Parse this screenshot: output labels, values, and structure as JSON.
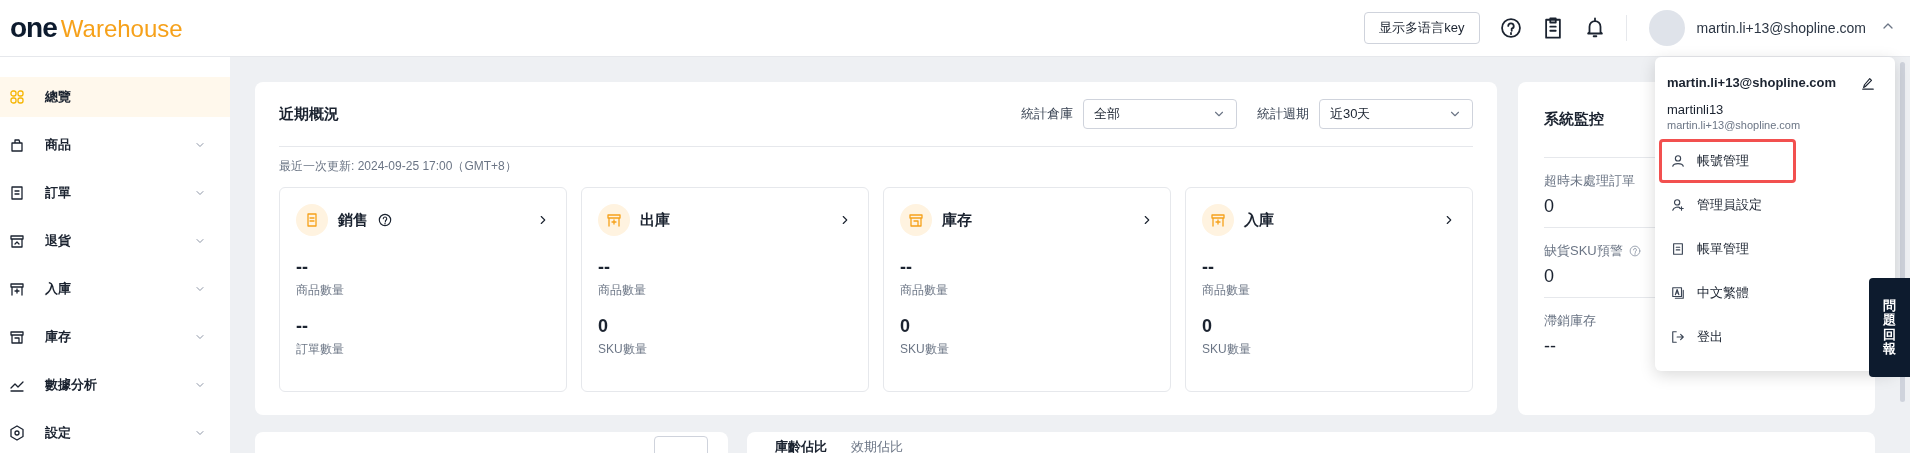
{
  "header": {
    "logo_one": "one",
    "logo_word": "Warehouse",
    "lang_key_button": "显示多语言key",
    "user_email": "martin.li+13@shopline.com",
    "menu_expanded": true
  },
  "sidebar": {
    "items": [
      {
        "label": "總覽",
        "selected": true,
        "expandable": false
      },
      {
        "label": "商品",
        "selected": false,
        "expandable": true
      },
      {
        "label": "訂單",
        "selected": false,
        "expandable": true
      },
      {
        "label": "退貨",
        "selected": false,
        "expandable": true
      },
      {
        "label": "入庫",
        "selected": false,
        "expandable": true
      },
      {
        "label": "庫存",
        "selected": false,
        "expandable": true
      },
      {
        "label": "數據分析",
        "selected": false,
        "expandable": true
      },
      {
        "label": "設定",
        "selected": false,
        "expandable": true
      }
    ]
  },
  "overview": {
    "title": "近期概況",
    "filters": [
      {
        "label": "統計倉庫",
        "value": "全部"
      },
      {
        "label": "統計週期",
        "value": "近30天"
      }
    ],
    "updated": "最近一次更新: 2024-09-25 17:00（GMT+8）",
    "cards": [
      {
        "title": "銷售",
        "help": true,
        "metrics": [
          {
            "value": "--",
            "label": "商品數量"
          },
          {
            "value": "--",
            "label": "訂單數量"
          }
        ]
      },
      {
        "title": "出庫",
        "help": false,
        "metrics": [
          {
            "value": "--",
            "label": "商品數量"
          },
          {
            "value": "0",
            "label": "SKU數量"
          }
        ]
      },
      {
        "title": "庫存",
        "help": false,
        "metrics": [
          {
            "value": "--",
            "label": "商品數量"
          },
          {
            "value": "0",
            "label": "SKU數量"
          }
        ]
      },
      {
        "title": "入庫",
        "help": false,
        "metrics": [
          {
            "value": "--",
            "label": "商品數量"
          },
          {
            "value": "0",
            "label": "SKU數量"
          }
        ]
      }
    ]
  },
  "monitor": {
    "title": "系統監控",
    "items": [
      {
        "label": "超時未處理訂單",
        "value": "0",
        "help": false
      },
      {
        "label": "缺貨SKU預警",
        "value": "0",
        "help": true
      },
      {
        "label": "滯銷庫存",
        "value": "--",
        "help": false
      }
    ]
  },
  "bottom_tabs": [
    {
      "label": "庫齡佔比",
      "selected": true
    },
    {
      "label": "效期佔比",
      "selected": false
    }
  ],
  "user_menu": {
    "email": "martin.li+13@shopline.com",
    "username": "martinli13",
    "sub_email": "martin.li+13@shopline.com",
    "items": [
      {
        "label": "帳號管理",
        "highlighted": true
      },
      {
        "label": "管理員設定",
        "highlighted": false
      },
      {
        "label": "帳單管理",
        "highlighted": false
      },
      {
        "label": "中文繁體",
        "highlighted": false
      },
      {
        "label": "登出",
        "highlighted": false
      }
    ]
  },
  "feedback_tab": "問題回報"
}
